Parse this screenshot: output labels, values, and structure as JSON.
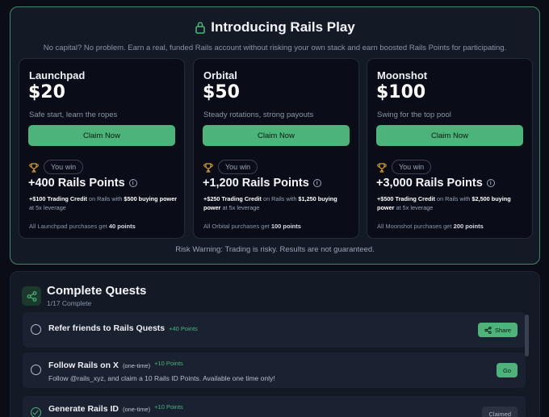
{
  "promo": {
    "title": "Introducing Rails Play",
    "subtitle": "No capital? No problem. Earn a real, funded Rails account without risking your own stack and earn boosted Rails Points for participating.",
    "risk_warning": "Risk Warning: Trading is risky. Results are not guaranteed.",
    "cards": [
      {
        "tier": "Launchpad",
        "price": "$20",
        "tagline": "Safe start, learn the ropes",
        "claim_label": "Claim Now",
        "win_label": "You win",
        "points": "+400 Rails Points",
        "credit": "+$100 Trading Credit",
        "on_rails_with": "on Rails with",
        "buying_power": "$500 buying power",
        "leverage": "at 5x leverage",
        "note_prefix": "All Launchpad purchases get",
        "note_points": "40 points"
      },
      {
        "tier": "Orbital",
        "price": "$50",
        "tagline": "Steady rotations, strong payouts",
        "claim_label": "Claim Now",
        "win_label": "You win",
        "points": "+1,200 Rails Points",
        "credit": "+$250 Trading Credit",
        "on_rails_with": "on Rails with",
        "buying_power": "$1,250 buying power",
        "leverage": "at 5x leverage",
        "note_prefix": "All Orbital purchases get",
        "note_points": "100 points"
      },
      {
        "tier": "Moonshot",
        "price": "$100",
        "tagline": "Swing for the top pool",
        "claim_label": "Claim Now",
        "win_label": "You win",
        "points": "+3,000 Rails Points",
        "credit": "+$500 Trading Credit",
        "on_rails_with": "on Rails with",
        "buying_power": "$2,500 buying power",
        "leverage": "at 5x leverage",
        "note_prefix": "All Moonshot purchases get",
        "note_points": "200 points"
      }
    ]
  },
  "quests": {
    "title": "Complete Quests",
    "progress": "1/17 Complete",
    "items": [
      {
        "title": "Refer friends to Rails Quests",
        "tag": "",
        "points": "+40 Points",
        "description": "",
        "button": "Share",
        "completed": false
      },
      {
        "title": "Follow Rails on X",
        "tag": "(one-time)",
        "points": "+10 Points",
        "description": "Follow @rails_xyz, and claim a 10 Rails ID Points. Available one time only!",
        "button": "Go",
        "completed": false
      },
      {
        "title": "Generate Rails ID",
        "tag": "(one-time)",
        "points": "+10 Points",
        "description": "",
        "button": "Claimed",
        "completed": true
      }
    ]
  },
  "colors": {
    "accent": "#4cb37a",
    "border_accent": "#3f8a64",
    "background": "#0b0d16",
    "panel": "#131a26"
  },
  "icons": {
    "title": "lock-icon",
    "win": "trophy-icon",
    "info": "info-icon",
    "quests": "share-icon",
    "share_button": "share-icon"
  }
}
